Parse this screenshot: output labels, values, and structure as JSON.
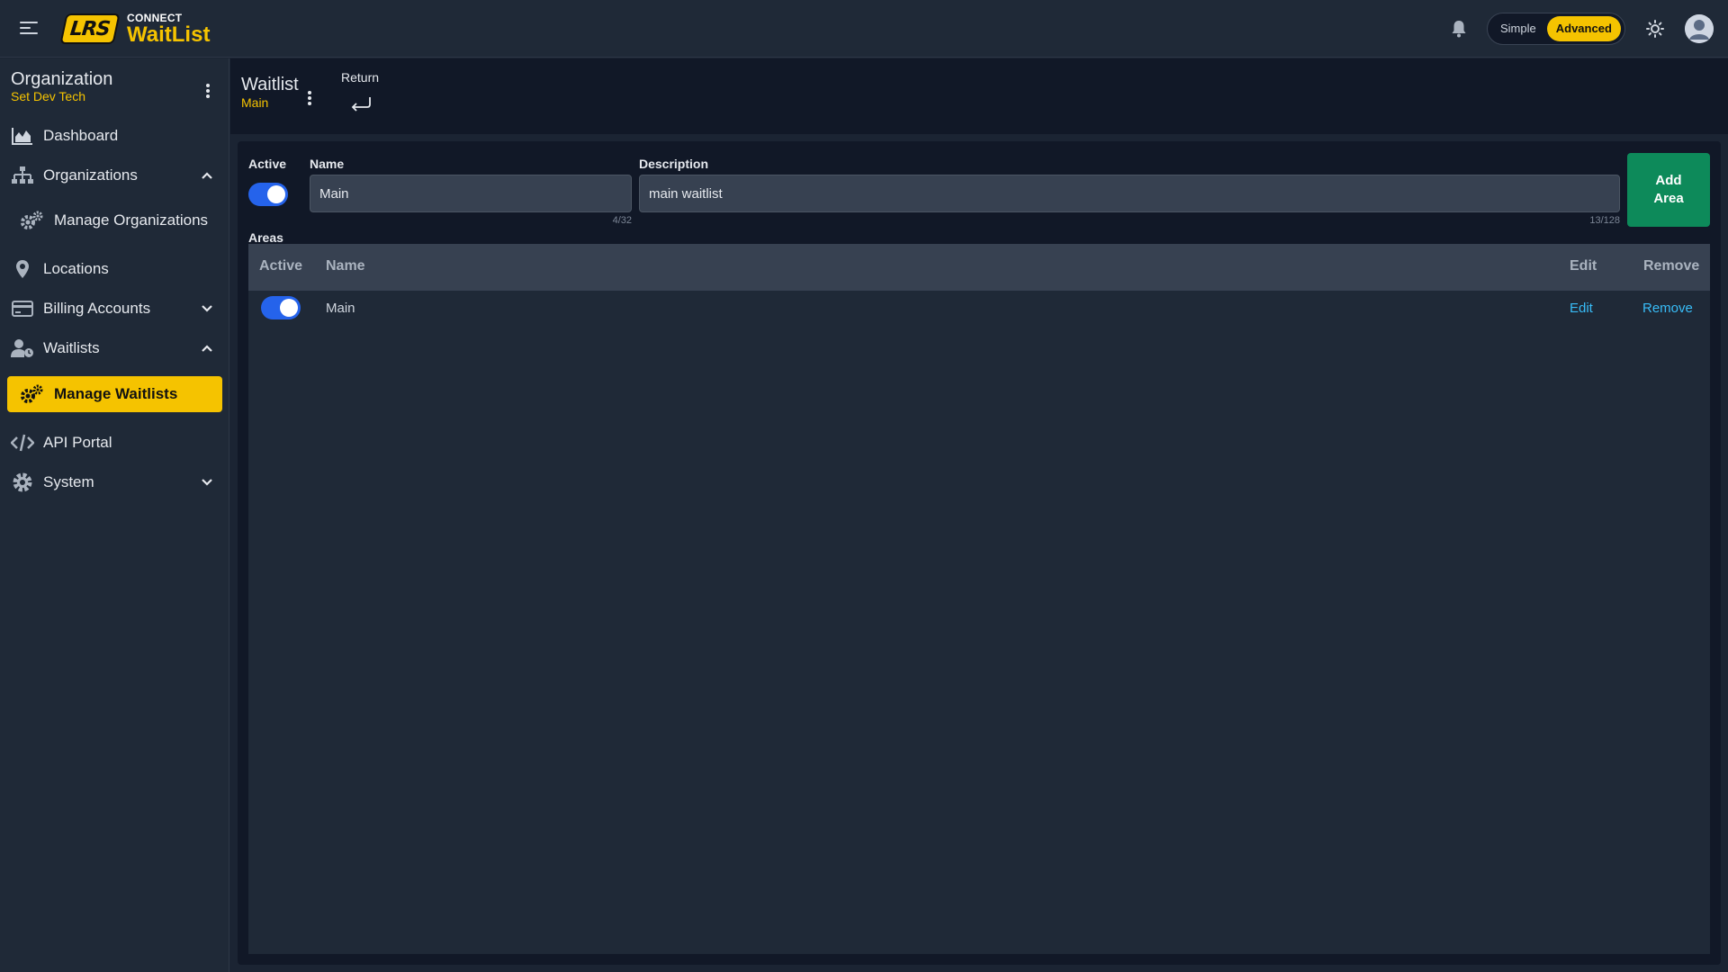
{
  "header": {
    "brand_small": "CONNECT",
    "brand_title": "WaitList",
    "logo_text": "LRS",
    "mode_simple": "Simple",
    "mode_advanced": "Advanced",
    "active_mode": "Advanced",
    "accent_color": "#f5c300"
  },
  "sidebar": {
    "org_title": "Organization",
    "org_name": "Set Dev Tech",
    "items": [
      {
        "label": "Dashboard",
        "icon": "chart-area-icon"
      },
      {
        "label": "Organizations",
        "icon": "sitemap-icon",
        "expanded": true
      },
      {
        "label": "Manage Organizations",
        "icon": "gears-icon",
        "sub": true
      },
      {
        "label": "Locations",
        "icon": "map-pin-icon"
      },
      {
        "label": "Billing Accounts",
        "icon": "credit-card-icon",
        "expanded": false
      },
      {
        "label": "Waitlists",
        "icon": "user-clock-icon",
        "expanded": true
      },
      {
        "label": "Manage Waitlists",
        "icon": "gears-icon",
        "sub": true,
        "active": true
      },
      {
        "label": "API Portal",
        "icon": "code-icon"
      },
      {
        "label": "System",
        "icon": "gear-icon",
        "expanded": false
      }
    ]
  },
  "page": {
    "title": "Waitlist",
    "subtitle": "Main",
    "return_label": "Return"
  },
  "form": {
    "active_label": "Active",
    "active_value": true,
    "name_label": "Name",
    "name_value": "Main",
    "name_counter": "4/32",
    "description_label": "Description",
    "description_value": "main waitlist",
    "description_counter": "13/128",
    "add_area_label": "Add\nArea",
    "areas_label": "Areas"
  },
  "table": {
    "columns": [
      "Active",
      "Name",
      "Edit",
      "Remove"
    ],
    "rows": [
      {
        "active": true,
        "name": "Main",
        "edit": "Edit",
        "remove": "Remove"
      }
    ]
  }
}
